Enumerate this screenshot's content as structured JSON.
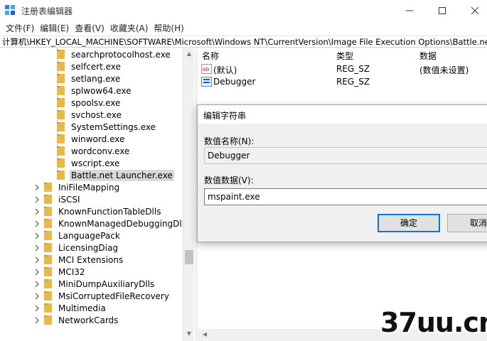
{
  "window": {
    "title": "注册表编辑器"
  },
  "menu": [
    "文件(F)",
    "编辑(E)",
    "查看(V)",
    "收藏夹(A)",
    "帮助(H)"
  ],
  "address": "计算机\\HKEY_LOCAL_MACHINE\\SOFTWARE\\Microsoft\\Windows NT\\CurrentVersion\\Image File Execution Options\\Battle.ne",
  "tree": {
    "children": [
      "searchprotocolhost.exe",
      "selfcert.exe",
      "setlang.exe",
      "splwow64.exe",
      "spoolsv.exe",
      "svchost.exe",
      "SystemSettings.exe",
      "winword.exe",
      "wordconv.exe",
      "wscript.exe",
      "Battle.net Launcher.exe"
    ],
    "siblings": [
      "IniFileMapping",
      "iSCSI",
      "KnownFunctionTableDlls",
      "KnownManagedDebuggingDlls",
      "LanguagePack",
      "LicensingDiag",
      "MCI Extensions",
      "MCI32",
      "MiniDumpAuxiliaryDlls",
      "MsiCorruptedFileRecovery",
      "Multimedia",
      "NetworkCards"
    ]
  },
  "list": {
    "headers": {
      "name": "名称",
      "type": "类型",
      "data": "数据"
    },
    "rows": [
      {
        "name": "(默认)",
        "type": "REG_SZ",
        "data": "(数值未设置)"
      },
      {
        "name": "Debugger",
        "type": "REG_SZ",
        "data": ""
      }
    ]
  },
  "dialog": {
    "title": "编辑字符串",
    "value_name_label": "数值名称(N):",
    "value_name": "Debugger",
    "value_data_label": "数值数据(V):",
    "value_data": "mspaint.exe",
    "ok_label": "确定",
    "cancel_label": "取消"
  },
  "watermark": "37uu.cn",
  "colors": {
    "folder": "#e8b84a",
    "accent": "#0078d7",
    "selection": "#d9d9d9"
  }
}
